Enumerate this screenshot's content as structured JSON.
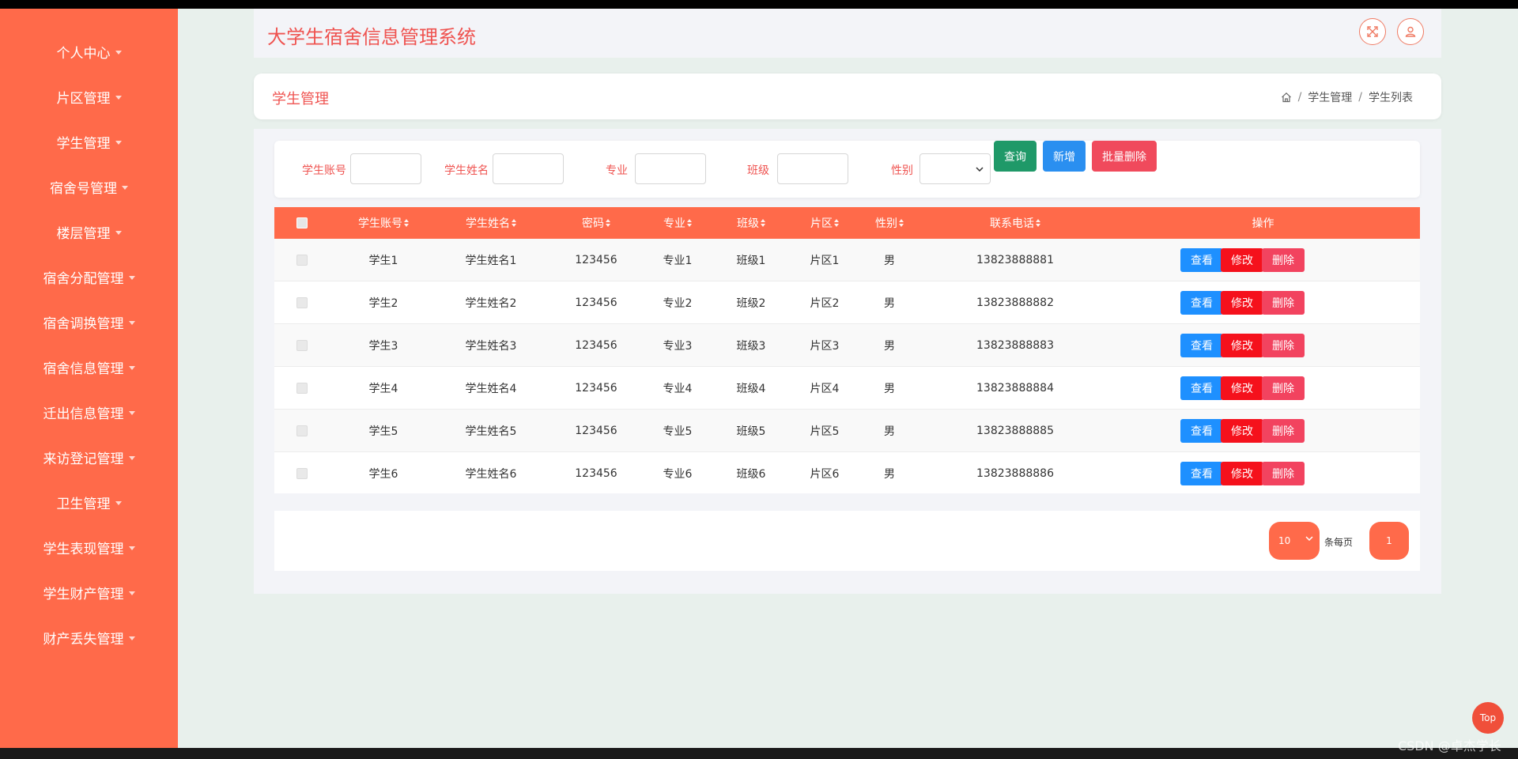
{
  "app": {
    "title": "大学生宿舍信息管理系统"
  },
  "sidebar": {
    "items": [
      {
        "label": "个人中心"
      },
      {
        "label": "片区管理"
      },
      {
        "label": "学生管理"
      },
      {
        "label": "宿舍号管理"
      },
      {
        "label": "楼层管理"
      },
      {
        "label": "宿舍分配管理"
      },
      {
        "label": "宿舍调换管理"
      },
      {
        "label": "宿舍信息管理"
      },
      {
        "label": "迁出信息管理"
      },
      {
        "label": "来访登记管理"
      },
      {
        "label": "卫生管理"
      },
      {
        "label": "学生表现管理"
      },
      {
        "label": "学生财产管理"
      },
      {
        "label": "财产丢失管理"
      }
    ]
  },
  "header": {
    "fullscreen_icon": "expand-icon",
    "user_icon": "user-icon"
  },
  "page": {
    "title": "学生管理",
    "breadcrumb": {
      "home_icon": "home-icon",
      "section": "学生管理",
      "current": "学生列表",
      "separator": "/"
    }
  },
  "search": {
    "account_label": "学生账号",
    "name_label": "学生姓名",
    "major_label": "专业",
    "class_label": "班级",
    "gender_label": "性别",
    "query_button": "查询",
    "add_button": "新增",
    "batch_delete_button": "批量删除"
  },
  "table": {
    "columns": [
      "学生账号",
      "学生姓名",
      "密码",
      "专业",
      "班级",
      "片区",
      "性别",
      "联系电话",
      "操作"
    ],
    "rows": [
      {
        "account": "学生1",
        "name": "学生姓名1",
        "password": "123456",
        "major": "专业1",
        "class": "班级1",
        "area": "片区1",
        "gender": "男",
        "phone": "13823888881"
      },
      {
        "account": "学生2",
        "name": "学生姓名2",
        "password": "123456",
        "major": "专业2",
        "class": "班级2",
        "area": "片区2",
        "gender": "男",
        "phone": "13823888882"
      },
      {
        "account": "学生3",
        "name": "学生姓名3",
        "password": "123456",
        "major": "专业3",
        "class": "班级3",
        "area": "片区3",
        "gender": "男",
        "phone": "13823888883"
      },
      {
        "account": "学生4",
        "name": "学生姓名4",
        "password": "123456",
        "major": "专业4",
        "class": "班级4",
        "area": "片区4",
        "gender": "男",
        "phone": "13823888884"
      },
      {
        "account": "学生5",
        "name": "学生姓名5",
        "password": "123456",
        "major": "专业5",
        "class": "班级5",
        "area": "片区5",
        "gender": "男",
        "phone": "13823888885"
      },
      {
        "account": "学生6",
        "name": "学生姓名6",
        "password": "123456",
        "major": "专业6",
        "class": "班级6",
        "area": "片区6",
        "gender": "男",
        "phone": "13823888886"
      }
    ],
    "actions": {
      "view": "查看",
      "edit": "修改",
      "delete": "删除"
    }
  },
  "pagination": {
    "page_size": "10",
    "per_page_label": "条每页",
    "current_page": "1"
  },
  "top_button": "Top",
  "watermark": "CSDN @卓杰学长",
  "colors": {
    "sidebar": "#ff6a4a",
    "title": "#ef5350",
    "query_button": "#1f9968",
    "add_button": "#2a8ff0",
    "batch_delete_button": "#f04a5c",
    "view_button": "#1e90ff",
    "edit_button": "#f5111c",
    "delete_button": "#f2435f"
  }
}
